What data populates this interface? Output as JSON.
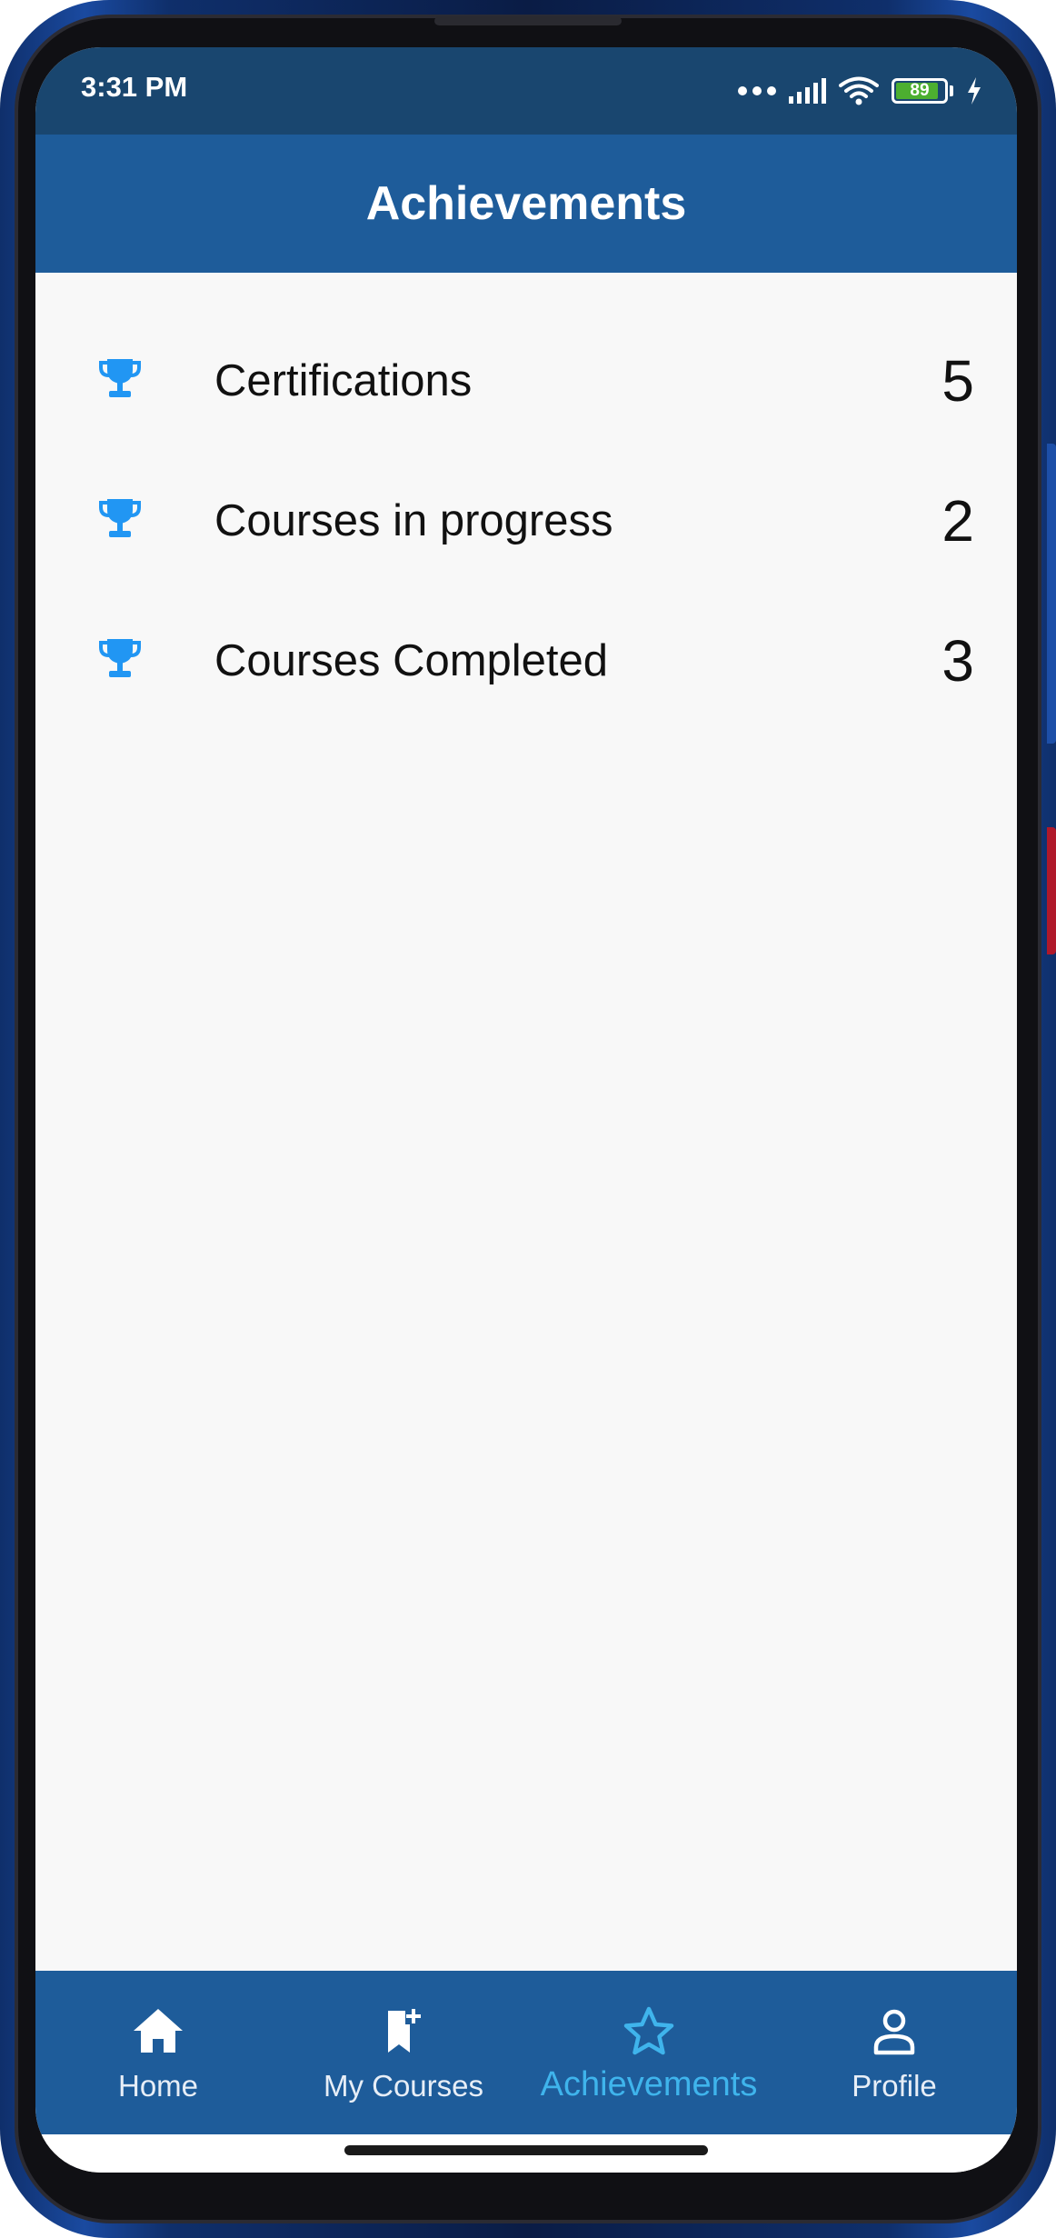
{
  "status_bar": {
    "time": "3:31 PM",
    "battery_level": "89"
  },
  "app_bar": {
    "title": "Achievements"
  },
  "achievements": [
    {
      "label": "Certifications",
      "count": "5",
      "icon": "trophy-icon"
    },
    {
      "label": "Courses in progress",
      "count": "2",
      "icon": "trophy-icon"
    },
    {
      "label": "Courses Completed",
      "count": "3",
      "icon": "trophy-icon"
    }
  ],
  "bottom_nav": {
    "items": [
      {
        "label": "Home",
        "icon": "home-icon",
        "active": false
      },
      {
        "label": "My Courses",
        "icon": "bookmark-add-icon",
        "active": false
      },
      {
        "label": "Achievements",
        "icon": "star-icon",
        "active": true
      },
      {
        "label": "Profile",
        "icon": "person-icon",
        "active": false
      }
    ]
  },
  "colors": {
    "app_bar": "#1e5c9a",
    "status_bar": "#19466f",
    "accent": "#3fb4ec",
    "trophy": "#2196f3",
    "background": "#f8f8f8"
  }
}
